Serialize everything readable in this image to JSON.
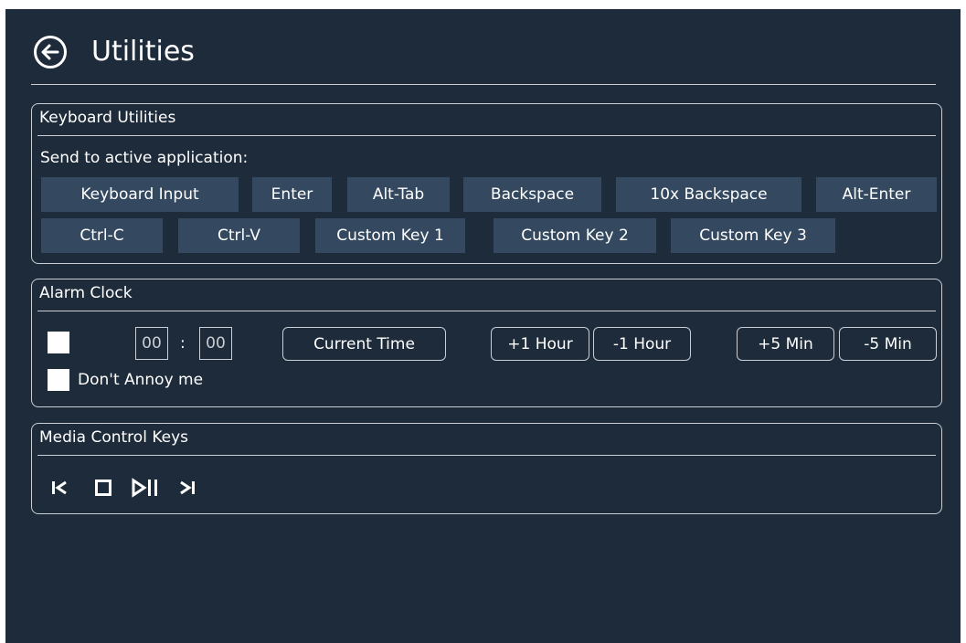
{
  "header": {
    "title": "Utilities",
    "back_icon": "arrow-left-circle-icon"
  },
  "keyboard": {
    "title": "Keyboard Utilities",
    "send_label": "Send to active application:",
    "row1": [
      "Keyboard Input",
      "Enter",
      "Alt-Tab",
      "Backspace",
      "10x Backspace",
      "Alt-Enter"
    ],
    "row2": [
      "Ctrl-C",
      "Ctrl-V",
      "Custom Key 1",
      "Custom Key 2",
      "Custom Key 3"
    ]
  },
  "alarm": {
    "title": "Alarm Clock",
    "hours": "00",
    "separator": ":",
    "minutes": "00",
    "current_time_label": "Current Time",
    "plus_hour_label": "+1 Hour",
    "minus_hour_label": "-1 Hour",
    "plus_min_label": "+5 Min",
    "minus_min_label": "-5 Min",
    "dont_annoy_label": "Don't Annoy me"
  },
  "media": {
    "title": "Media Control Keys",
    "icons": [
      "previous-track-icon",
      "stop-icon",
      "play-pause-icon",
      "next-track-icon"
    ]
  },
  "colors": {
    "background": "#1e2b3a",
    "button": "#34495f",
    "border": "#c9ced4"
  }
}
